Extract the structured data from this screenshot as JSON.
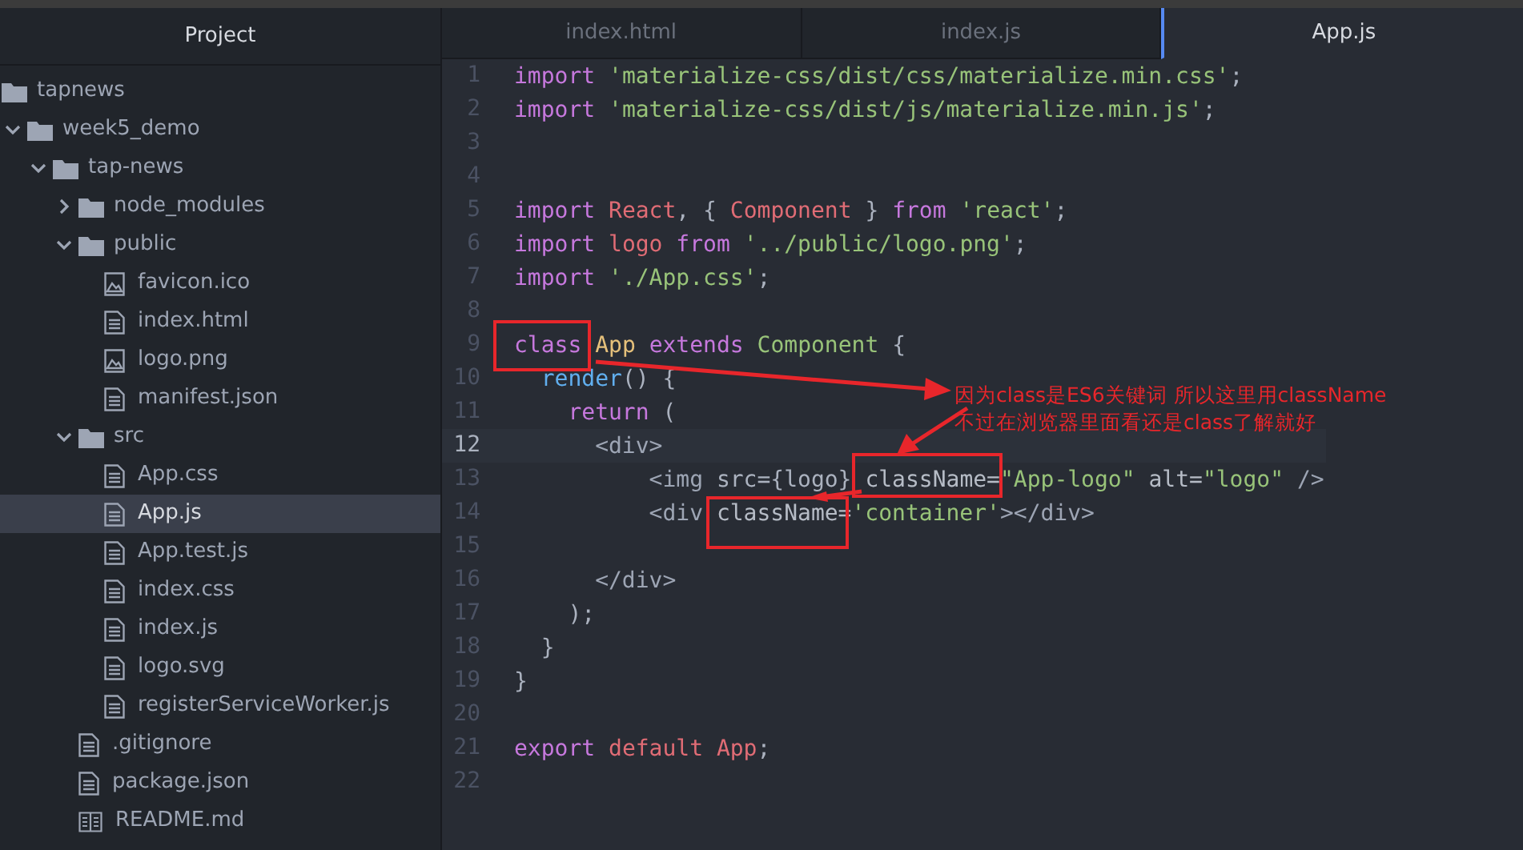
{
  "sidebar": {
    "title": "Project",
    "tree": [
      {
        "name": "tapnews",
        "kind": "folder",
        "selected": false,
        "children": [
          {
            "name": "week5_demo",
            "kind": "folder",
            "expanded": true,
            "selected": false,
            "children": [
              {
                "name": "tap-news",
                "kind": "folder",
                "expanded": true,
                "selected": false,
                "children": [
                  {
                    "name": "node_modules",
                    "kind": "folder",
                    "expanded": false,
                    "selected": false
                  },
                  {
                    "name": "public",
                    "kind": "folder",
                    "expanded": true,
                    "selected": false,
                    "children": [
                      {
                        "name": "favicon.ico",
                        "kind": "image",
                        "selected": false
                      },
                      {
                        "name": "index.html",
                        "kind": "file",
                        "selected": false
                      },
                      {
                        "name": "logo.png",
                        "kind": "image",
                        "selected": false
                      },
                      {
                        "name": "manifest.json",
                        "kind": "file",
                        "selected": false
                      }
                    ]
                  },
                  {
                    "name": "src",
                    "kind": "folder",
                    "expanded": true,
                    "selected": false,
                    "children": [
                      {
                        "name": "App.css",
                        "kind": "file",
                        "selected": false
                      },
                      {
                        "name": "App.js",
                        "kind": "file",
                        "selected": true
                      },
                      {
                        "name": "App.test.js",
                        "kind": "file",
                        "selected": false
                      },
                      {
                        "name": "index.css",
                        "kind": "file",
                        "selected": false
                      },
                      {
                        "name": "index.js",
                        "kind": "file",
                        "selected": false
                      },
                      {
                        "name": "logo.svg",
                        "kind": "file",
                        "selected": false
                      },
                      {
                        "name": "registerServiceWorker.js",
                        "kind": "file",
                        "selected": false
                      }
                    ]
                  },
                  {
                    "name": ".gitignore",
                    "kind": "file",
                    "selected": false
                  },
                  {
                    "name": "package.json",
                    "kind": "file",
                    "selected": false
                  },
                  {
                    "name": "README.md",
                    "kind": "readme",
                    "selected": false
                  }
                ]
              }
            ]
          }
        ]
      }
    ]
  },
  "tabs": [
    {
      "label": "index.html",
      "selected": false
    },
    {
      "label": "index.js",
      "selected": false
    },
    {
      "label": "App.js",
      "selected": true
    }
  ],
  "editor": {
    "lines": [
      {
        "number": "1",
        "current": false,
        "tokens": [
          {
            "kind": "keyword",
            "text": "import "
          },
          {
            "kind": "string",
            "text": "'materialize-css/dist/css/materialize.min.css'"
          },
          {
            "kind": "plain",
            "text": ";"
          }
        ]
      },
      {
        "number": "2",
        "current": false,
        "tokens": [
          {
            "kind": "keyword",
            "text": "import "
          },
          {
            "kind": "string",
            "text": "'materialize-css/dist/js/materialize.min.js'"
          },
          {
            "kind": "plain",
            "text": ";"
          }
        ]
      },
      {
        "number": "3",
        "current": false
      },
      {
        "number": "4",
        "current": false
      },
      {
        "number": "5",
        "current": false,
        "tokens": [
          {
            "kind": "keyword",
            "text": "import "
          },
          {
            "kind": "variable",
            "text": "React"
          },
          {
            "kind": "plain",
            "text": ", { "
          },
          {
            "kind": "variable",
            "text": "Component"
          },
          {
            "kind": "plain",
            "text": " } "
          },
          {
            "kind": "keyword",
            "text": "from "
          },
          {
            "kind": "string",
            "text": "'react'"
          },
          {
            "kind": "plain",
            "text": ";"
          }
        ]
      },
      {
        "number": "6",
        "current": false,
        "tokens": [
          {
            "kind": "keyword",
            "text": "import "
          },
          {
            "kind": "variable",
            "text": "logo "
          },
          {
            "kind": "keyword",
            "text": "from "
          },
          {
            "kind": "string",
            "text": "'../public/logo.png'"
          },
          {
            "kind": "plain",
            "text": ";"
          }
        ]
      },
      {
        "number": "7",
        "current": false,
        "tokens": [
          {
            "kind": "keyword",
            "text": "import "
          },
          {
            "kind": "string",
            "text": "'./App.css'"
          },
          {
            "kind": "plain",
            "text": ";"
          }
        ]
      },
      {
        "number": "8",
        "current": false
      },
      {
        "number": "9",
        "current": false,
        "tokens": [
          {
            "kind": "keyword",
            "text": "class "
          },
          {
            "kind": "classname",
            "text": "App "
          },
          {
            "kind": "keyword",
            "text": "extends "
          },
          {
            "kind": "inherit",
            "text": "Component"
          },
          {
            "kind": "plain",
            "text": " {"
          }
        ]
      },
      {
        "number": "10",
        "current": false,
        "tokens": [
          {
            "kind": "function",
            "text": "  render"
          },
          {
            "kind": "plain",
            "text": "() {"
          }
        ]
      },
      {
        "number": "11",
        "current": false,
        "tokens": [
          {
            "kind": "keyword",
            "text": "    return"
          },
          {
            "kind": "plain",
            "text": " ("
          }
        ]
      },
      {
        "number": "12",
        "current": true,
        "tokens": [
          {
            "kind": "tag",
            "text": "      <div>"
          }
        ]
      },
      {
        "number": "13",
        "current": false,
        "tokens": [
          {
            "kind": "tag",
            "text": "          <img"
          },
          {
            "kind": "plain",
            "text": " src={logo} "
          },
          {
            "kind": "attribute",
            "text": "className="
          },
          {
            "kind": "string",
            "text": "\"App-logo\""
          },
          {
            "kind": "attribute",
            "text": " alt="
          },
          {
            "kind": "string",
            "text": "\"logo\""
          },
          {
            "kind": "tag",
            "text": " />"
          }
        ]
      },
      {
        "number": "14",
        "current": false,
        "tokens": [
          {
            "kind": "tag",
            "text": "          <div "
          },
          {
            "kind": "attribute",
            "text": "className="
          },
          {
            "kind": "string",
            "text": "'container'"
          },
          {
            "kind": "tag",
            "text": "></div>"
          }
        ]
      },
      {
        "number": "15",
        "current": false
      },
      {
        "number": "16",
        "current": false,
        "tokens": [
          {
            "kind": "tag",
            "text": "      </div>"
          }
        ]
      },
      {
        "number": "17",
        "current": false,
        "tokens": [
          {
            "kind": "plain",
            "text": "    );"
          }
        ]
      },
      {
        "number": "18",
        "current": false,
        "tokens": [
          {
            "kind": "plain",
            "text": "  }"
          }
        ]
      },
      {
        "number": "19",
        "current": false,
        "tokens": [
          {
            "kind": "plain",
            "text": "}"
          }
        ]
      },
      {
        "number": "20",
        "current": false
      },
      {
        "number": "21",
        "current": false,
        "tokens": [
          {
            "kind": "keyword",
            "text": "export "
          },
          {
            "kind": "variable",
            "text": "default App"
          },
          {
            "kind": "plain",
            "text": ";"
          }
        ]
      },
      {
        "number": "22",
        "current": false
      }
    ]
  },
  "annotation": {
    "note": "因为class是ES6关键词 所以这里用className\n不过在浏览器里面看还是class了解就好"
  }
}
